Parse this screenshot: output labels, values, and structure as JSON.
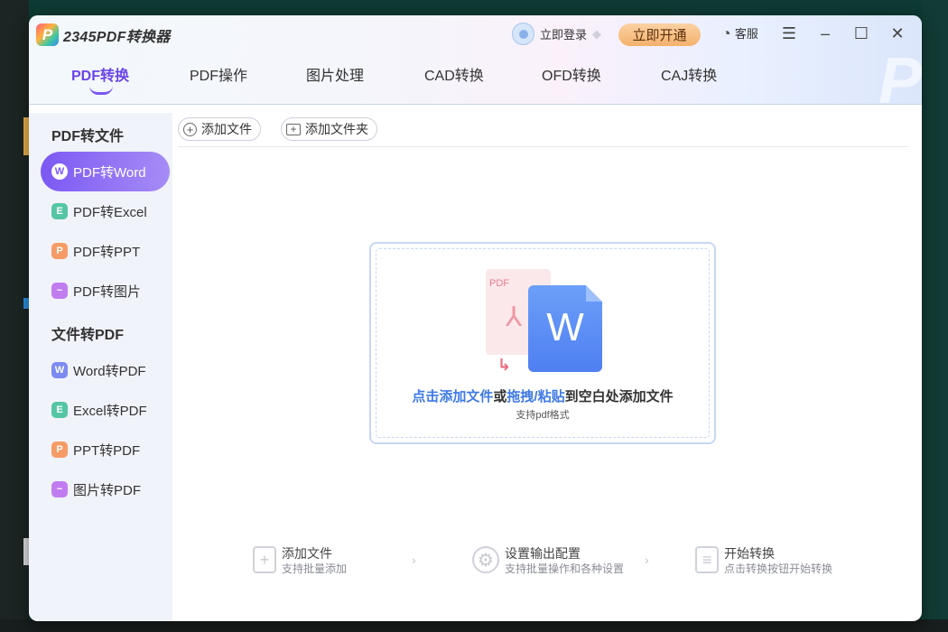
{
  "app": {
    "logo_text": "2345PDF转换器",
    "logo_mark": "P",
    "login_label": "立即登录",
    "vip_label": "立即开通",
    "service_label": "客服"
  },
  "tabs": [
    {
      "label": "PDF转换",
      "active": true
    },
    {
      "label": "PDF操作",
      "active": false
    },
    {
      "label": "图片处理",
      "active": false
    },
    {
      "label": "CAD转换",
      "active": false
    },
    {
      "label": "OFD转换",
      "active": false
    },
    {
      "label": "CAJ转换",
      "active": false
    }
  ],
  "sidebar": {
    "group1": "PDF转文件",
    "group2": "文件转PDF",
    "items": [
      {
        "label": "PDF转Word",
        "icon": "word-icon",
        "glyph": "W"
      },
      {
        "label": "PDF转Excel",
        "icon": "excel-icon",
        "glyph": "E"
      },
      {
        "label": "PDF转PPT",
        "icon": "ppt-icon",
        "glyph": "P"
      },
      {
        "label": "PDF转图片",
        "icon": "image-icon",
        "glyph": "~"
      },
      {
        "label": "Word转PDF",
        "icon": "word-icon",
        "glyph": "W"
      },
      {
        "label": "Excel转PDF",
        "icon": "excel-icon",
        "glyph": "E"
      },
      {
        "label": "PPT转PDF",
        "icon": "ppt-icon",
        "glyph": "P"
      },
      {
        "label": "图片转PDF",
        "icon": "image-icon",
        "glyph": "~"
      }
    ]
  },
  "toolbar": {
    "add_file": "添加文件",
    "add_folder": "添加文件夹"
  },
  "dropzone": {
    "pdf_label": "PDF",
    "word_label": "W",
    "text_click": "点击添加文件",
    "text_or": "或",
    "text_drag": "拖拽/粘贴",
    "text_rest": "到空白处添加文件",
    "sub": "支持pdf格式"
  },
  "steps": [
    {
      "title": "添加文件",
      "sub": "支持批量添加",
      "icon": "add-file-icon"
    },
    {
      "title": "设置输出配置",
      "sub": "支持批量操作和各种设置",
      "icon": "settings-icon"
    },
    {
      "title": "开始转换",
      "sub": "点击转换按钮开始转换",
      "icon": "convert-icon"
    }
  ],
  "colors": {
    "accent": "#7a56f0",
    "link_blue": "#3e7ae8",
    "vip_gold": "#f4b16c"
  }
}
